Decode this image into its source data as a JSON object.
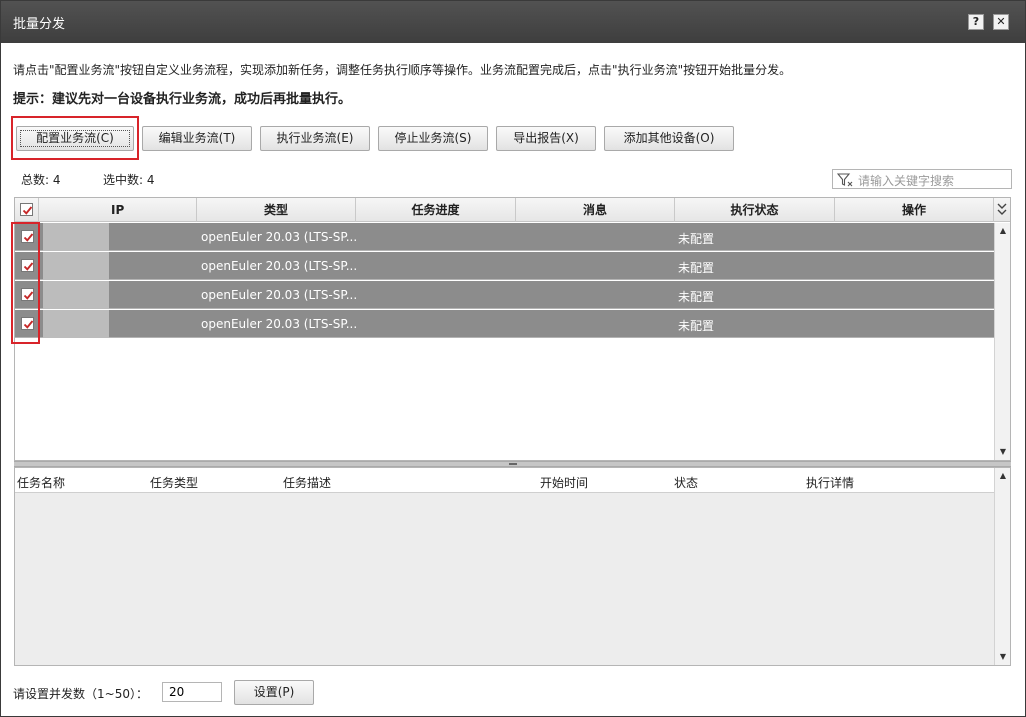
{
  "window": {
    "title": "批量分发",
    "help_label": "?",
    "close_label": "✕"
  },
  "description": "请点击\"配置业务流\"按钮自定义业务流程，实现添加新任务，调整任务执行顺序等操作。业务流配置完成后，点击\"执行业务流\"按钮开始批量分发。",
  "hint": "提示：建议先对一台设备执行业务流，成功后再批量执行。",
  "toolbar": {
    "configure": "配置业务流(C)",
    "edit": "编辑业务流(T)",
    "execute": "执行业务流(E)",
    "stop": "停止业务流(S)",
    "export": "导出报告(X)",
    "add_device": "添加其他设备(O)"
  },
  "counts": {
    "total_label": "总数: 4",
    "selected_label": "选中数: 4"
  },
  "search": {
    "placeholder": "请输入关键字搜索"
  },
  "grid": {
    "columns": [
      "IP",
      "类型",
      "任务进度",
      "消息",
      "执行状态",
      "操作"
    ],
    "rows": [
      {
        "checked": true,
        "type": "openEuler 20.03 (LTS-SP...",
        "progress": "",
        "message": "",
        "status": "未配置"
      },
      {
        "checked": true,
        "type": "openEuler 20.03 (LTS-SP...",
        "progress": "",
        "message": "",
        "status": "未配置"
      },
      {
        "checked": true,
        "type": "openEuler 20.03 (LTS-SP...",
        "progress": "",
        "message": "",
        "status": "未配置"
      },
      {
        "checked": true,
        "type": "openEuler 20.03 (LTS-SP...",
        "progress": "",
        "message": "",
        "status": "未配置"
      }
    ]
  },
  "tasks": {
    "columns": [
      "任务名称",
      "任务类型",
      "任务描述",
      "开始时间",
      "状态",
      "执行详情"
    ],
    "rows": []
  },
  "footer": {
    "concurrency_label": "请设置并发数（1~50）：",
    "concurrency_value": "20",
    "set_button": "设置(P)"
  },
  "colors": {
    "title_bar": "#464646",
    "highlight": "#d8242a",
    "selected_row": "#8c8c8c"
  },
  "icons": [
    "help-icon",
    "close-icon",
    "filter-icon",
    "checkmark-icon",
    "chevron-double-down-icon",
    "scroll-up-icon",
    "scroll-down-icon"
  ]
}
